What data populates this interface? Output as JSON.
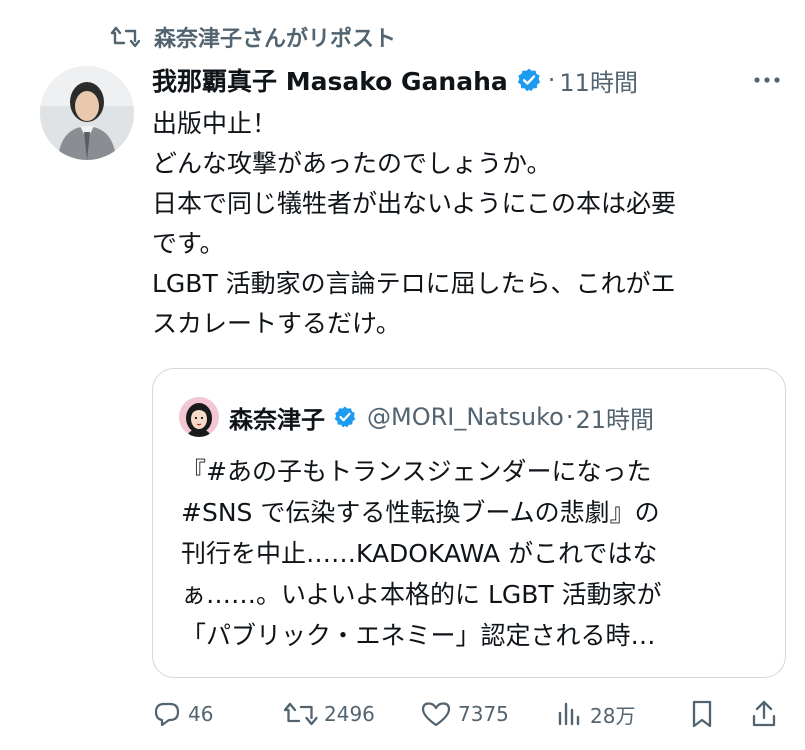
{
  "repost": {
    "text": "森奈津子さんがリポスト",
    "icon": "repost-icon"
  },
  "tweet": {
    "author_name": "我那覇真子 Masako Ganaha",
    "dot": "·",
    "time": "11時間",
    "lines": [
      "出版中止！",
      "どんな攻撃があったのでしょうか。",
      "日本で同じ犠牲者が出ないようにこの本は必要",
      "です。",
      "LGBT 活動家の言論テロに屈したら、これがエ",
      "スカレートするだけ。"
    ]
  },
  "quote": {
    "name": "森奈津子",
    "handle": "@MORI_Natsuko",
    "dot": "·",
    "time": "21時間",
    "lines": [
      "『#あの子もトランスジェンダーになった",
      "#SNS で伝染する性転換ブームの悲劇』の",
      "刊行を中止……KADOKAWA がこれではな",
      "ぁ……。いよいよ本格的に LGBT 活動家が",
      "「パブリック・エネミー」認定される時…"
    ]
  },
  "actions": {
    "replies": "46",
    "reposts": "2496",
    "likes": "7375",
    "views": "28万"
  },
  "colors": {
    "text": "#0f1419",
    "secondary": "#536471",
    "verified": "#1d9bf0",
    "border": "#cfd9de"
  }
}
